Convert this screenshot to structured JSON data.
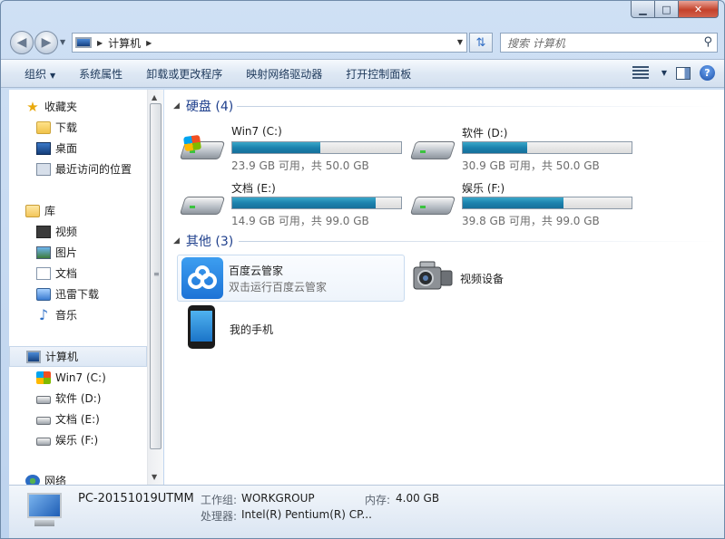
{
  "address": {
    "path": "计算机"
  },
  "search": {
    "placeholder": "搜索 计算机"
  },
  "toolbar": {
    "items": [
      "组织",
      "系统属性",
      "卸载或更改程序",
      "映射网络驱动器",
      "打开控制面板"
    ]
  },
  "nav": {
    "favorites": {
      "head": "收藏夹",
      "items": [
        "下载",
        "桌面",
        "最近访问的位置"
      ]
    },
    "libraries": {
      "head": "库",
      "items": [
        "视频",
        "图片",
        "文档",
        "迅雷下载",
        "音乐"
      ]
    },
    "computer": {
      "head": "计算机",
      "items": [
        "Win7 (C:)",
        "软件 (D:)",
        "文档 (E:)",
        "娱乐 (F:)"
      ]
    },
    "network": {
      "head": "网络"
    }
  },
  "sections": {
    "drives_title": "硬盘 (4)",
    "others_title": "其他 (3)"
  },
  "drives": [
    {
      "name": "Win7 (C:)",
      "info": "23.9 GB 可用，共 50.0 GB",
      "used_fraction": 0.522
    },
    {
      "name": "软件 (D:)",
      "info": "30.9 GB 可用，共 50.0 GB",
      "used_fraction": 0.382
    },
    {
      "name": "文档 (E:)",
      "info": "14.9 GB 可用，共 99.0 GB",
      "used_fraction": 0.849
    },
    {
      "name": "娱乐 (F:)",
      "info": "39.8 GB 可用，共 99.0 GB",
      "used_fraction": 0.598
    }
  ],
  "others": [
    {
      "name": "百度云管家",
      "desc": "双击运行百度云管家"
    },
    {
      "name": "视频设备"
    },
    {
      "name": "我的手机"
    }
  ],
  "details": {
    "pc_name": "PC-20151019UTMM",
    "workgroup_label": "工作组:",
    "workgroup_value": "WORKGROUP",
    "memory_label": "内存:",
    "memory_value": "4.00 GB",
    "cpu_label": "处理器:",
    "cpu_value": "Intel(R) Pentium(R) CP..."
  },
  "colors": {
    "accent": "#1e3f8c",
    "bar_fill": "#1c82ae",
    "close": "#c4422b"
  }
}
